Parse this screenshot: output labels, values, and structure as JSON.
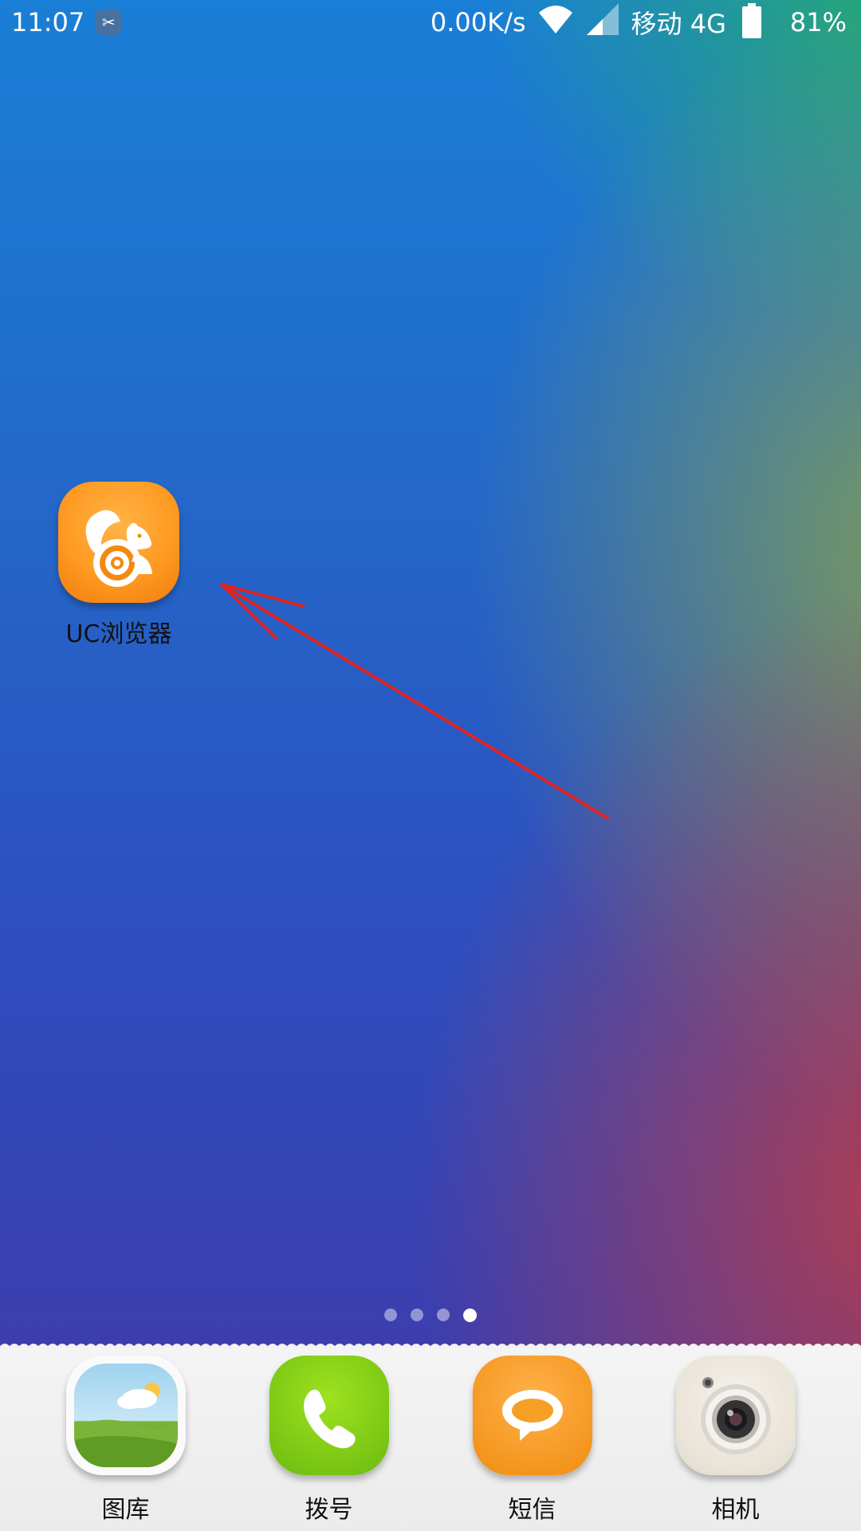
{
  "status_bar": {
    "time": "11:07",
    "network_speed": "0.00K/s",
    "carrier": "移动 4G",
    "battery": "81%",
    "icons": [
      "notification-icon",
      "wifi-icon",
      "signal-icon",
      "battery-icon"
    ]
  },
  "home_apps": [
    {
      "label": "UC浏览器",
      "icon": "uc-browser-icon"
    }
  ],
  "page_indicator": {
    "pages": 4,
    "current": 4
  },
  "dock": [
    {
      "label": "图库",
      "icon": "gallery-icon"
    },
    {
      "label": "拨号",
      "icon": "phone-icon"
    },
    {
      "label": "短信",
      "icon": "sms-icon"
    },
    {
      "label": "相机",
      "icon": "camera-icon"
    }
  ],
  "annotation": {
    "color": "#e02424"
  },
  "colors": {
    "uc_orange": "#ff9a22",
    "phone_green": "#7ccc14",
    "sms_orange": "#f9a32c"
  }
}
